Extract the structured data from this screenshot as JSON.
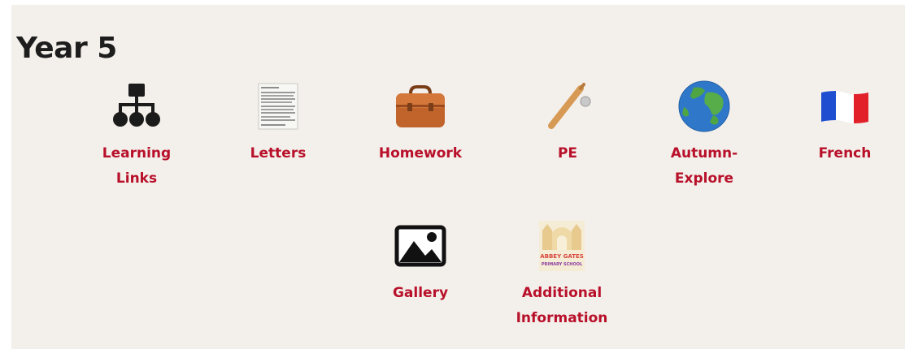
{
  "section": {
    "title": "Year 5"
  },
  "tiles": [
    {
      "label": "Learning Links",
      "icon": "sitemap-icon"
    },
    {
      "label": "Letters",
      "icon": "letter-document-icon"
    },
    {
      "label": "Homework",
      "icon": "briefcase-icon"
    },
    {
      "label": "PE",
      "icon": "cricket-bat-icon"
    },
    {
      "label": "Autumn-Explore",
      "icon": "globe-icon"
    },
    {
      "label": "French",
      "icon": "french-flag-icon"
    },
    {
      "label": "Gallery",
      "icon": "image-icon"
    },
    {
      "label": "Additional Information",
      "icon": "school-logo-icon"
    }
  ],
  "school_logo": {
    "line1": "ABBEY GATES",
    "line2": "PRIMARY SCHOOL"
  },
  "colors": {
    "background": "#f3efea",
    "link": "#b8102a",
    "heading": "#1d1d1d"
  }
}
